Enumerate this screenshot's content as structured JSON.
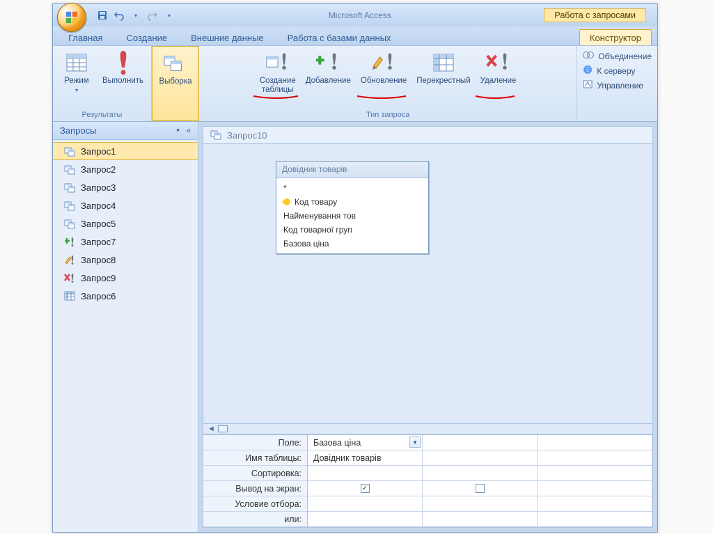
{
  "titlebar": {
    "app_title": "Microsoft Access",
    "context_title": "Работа с запросами"
  },
  "tabs": {
    "home": "Главная",
    "create": "Создание",
    "external": "Внешние данные",
    "dbtools": "Работа с базами данных",
    "design": "Конструктор"
  },
  "ribbon": {
    "results": {
      "view": "Режим",
      "run": "Выполнить",
      "group_label": "Результаты"
    },
    "query_type": {
      "select": "Выборка",
      "make_table": "Создание\nтаблицы",
      "append": "Добавление",
      "update": "Обновление",
      "crosstab": "Перекрестный",
      "delete": "Удаление",
      "group_label": "Тип запроса"
    },
    "side": {
      "union": "Объединение",
      "passthrough": "К серверу",
      "datadef": "Управление"
    }
  },
  "nav": {
    "header": "Запросы",
    "items": [
      {
        "label": "Запрос1",
        "icon": "select",
        "selected": true
      },
      {
        "label": "Запрос2",
        "icon": "select",
        "selected": false
      },
      {
        "label": "Запрос3",
        "icon": "select",
        "selected": false
      },
      {
        "label": "Запрос4",
        "icon": "select",
        "selected": false
      },
      {
        "label": "Запрос5",
        "icon": "select",
        "selected": false
      },
      {
        "label": "Запрос7",
        "icon": "append",
        "selected": false
      },
      {
        "label": "Запрос8",
        "icon": "update",
        "selected": false
      },
      {
        "label": "Запрос9",
        "icon": "delete",
        "selected": false
      },
      {
        "label": "Запрос6",
        "icon": "crosstab",
        "selected": false
      }
    ]
  },
  "doc": {
    "tab_title": "Запрос10",
    "table": {
      "title": "Довідник товарів",
      "fields": {
        "star": "*",
        "f1": "Код товару",
        "f2": "Найменування тов",
        "f3": "Код товарної груп",
        "f4": "Базова ціна"
      }
    }
  },
  "grid": {
    "labels": {
      "field": "Поле:",
      "table": "Имя таблицы:",
      "sort": "Сортировка:",
      "show": "Вывод на экран:",
      "criteria": "Условие отбора:",
      "or": "или:"
    },
    "col1": {
      "field": "Базова ціна",
      "table": "Довідник товарів",
      "show_checked": true
    }
  }
}
